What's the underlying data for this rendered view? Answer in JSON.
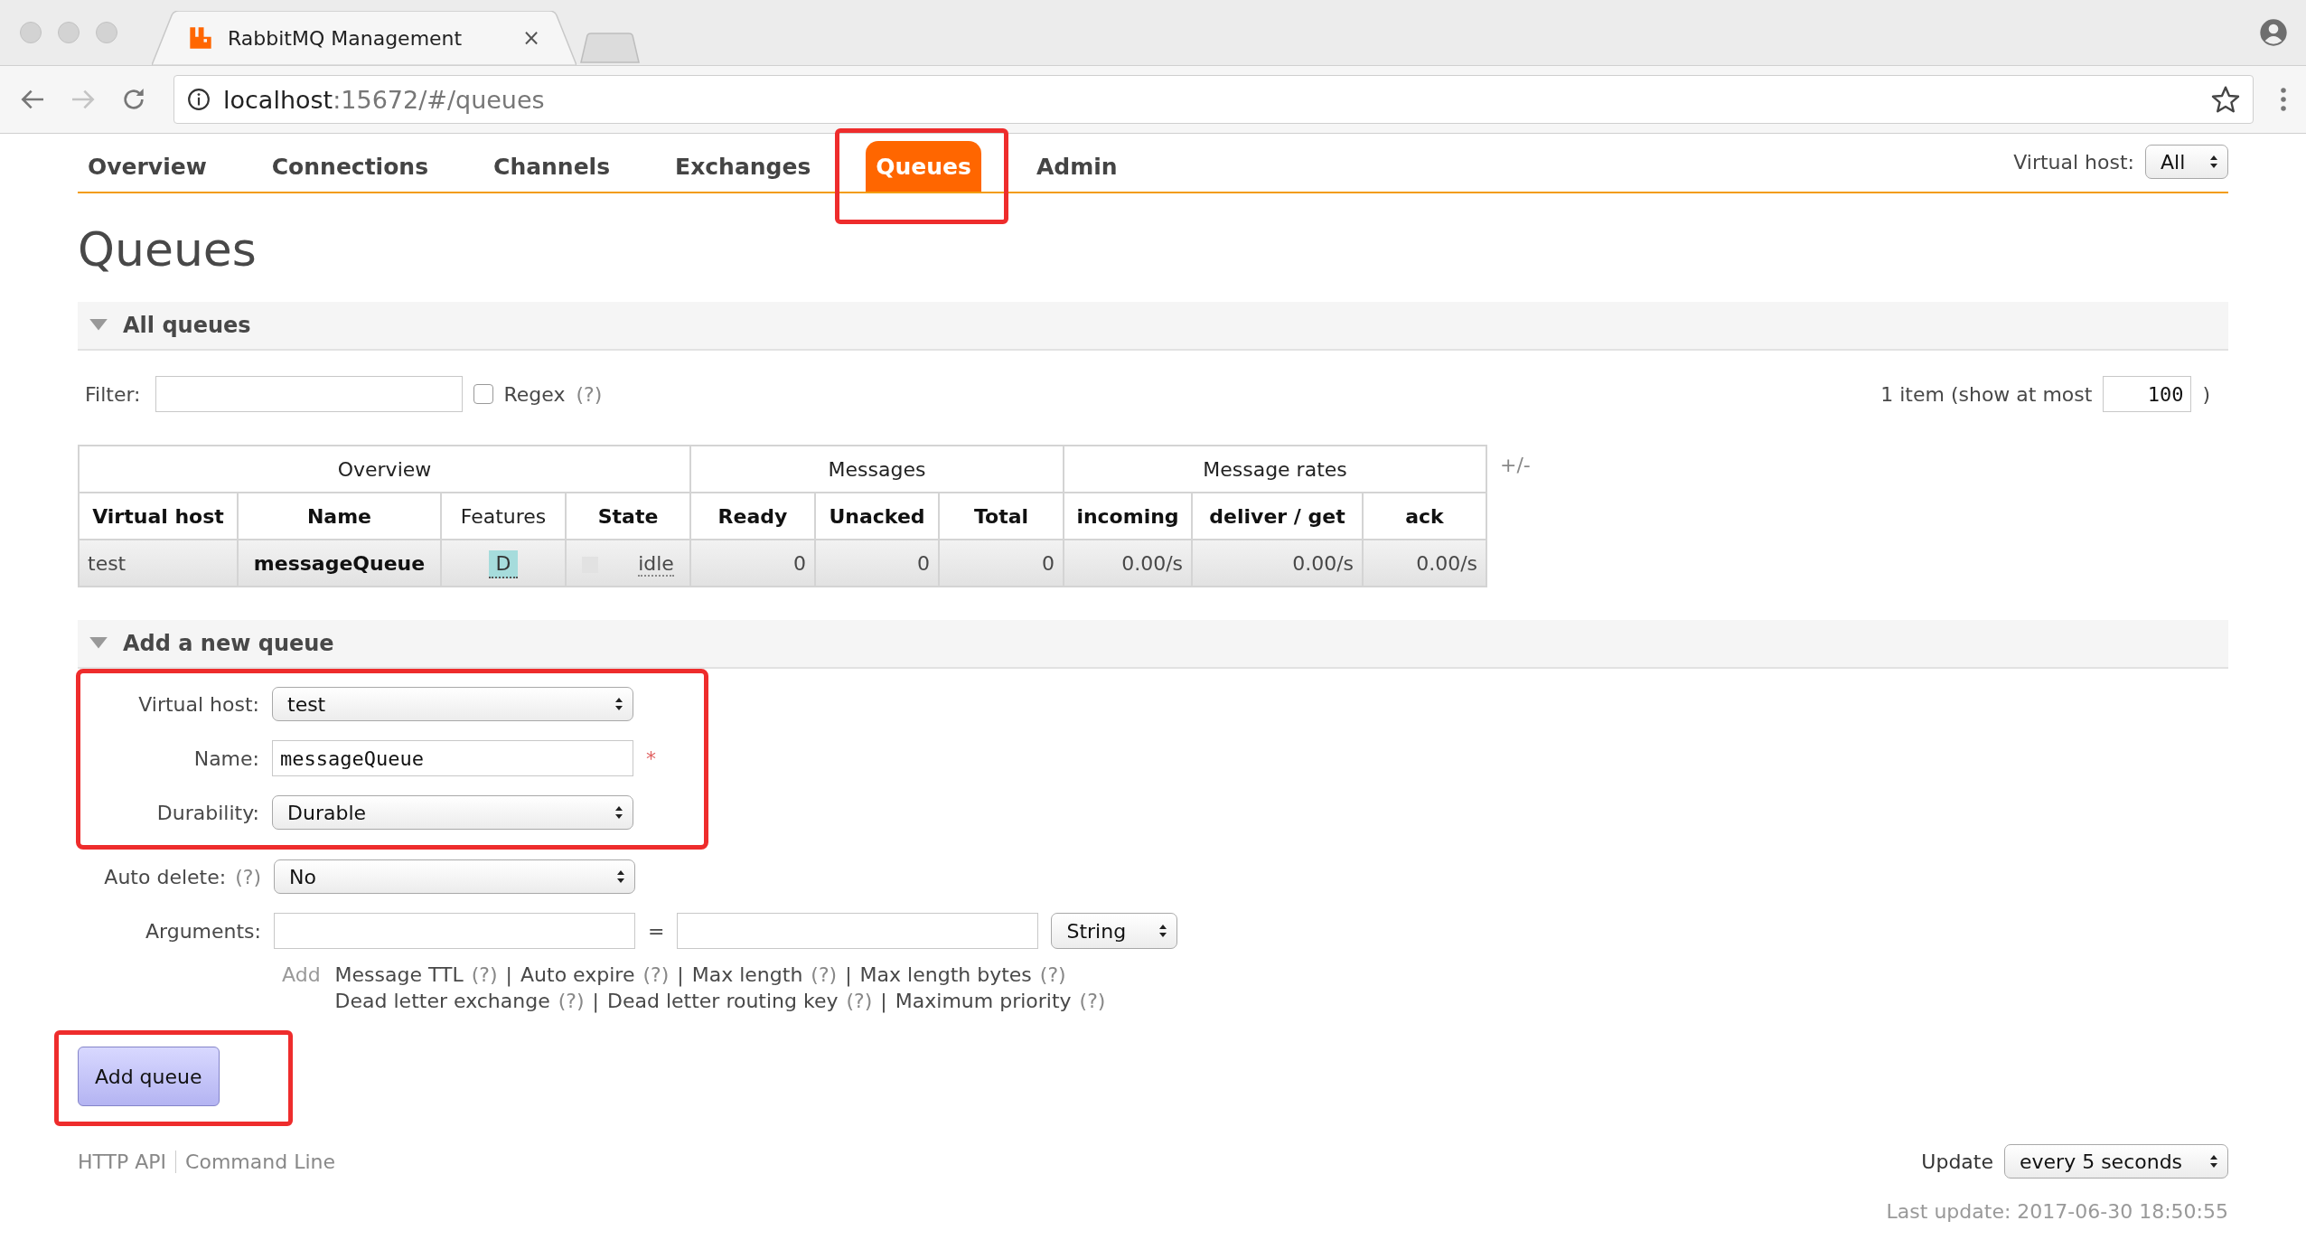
{
  "browser": {
    "tab_title": "RabbitMQ Management",
    "tab_close": "×",
    "url_host": "localhost",
    "url_rest": ":15672/#/queues"
  },
  "nav": {
    "tabs": [
      {
        "label": "Overview",
        "selected": false,
        "highlighted": false
      },
      {
        "label": "Connections",
        "selected": false,
        "highlighted": false
      },
      {
        "label": "Channels",
        "selected": false,
        "highlighted": false
      },
      {
        "label": "Exchanges",
        "selected": false,
        "highlighted": false
      },
      {
        "label": "Queues",
        "selected": true,
        "highlighted": true
      },
      {
        "label": "Admin",
        "selected": false,
        "highlighted": false
      }
    ],
    "vhost_label": "Virtual host:",
    "vhost_value": "All"
  },
  "page_title": "Queues",
  "all_queues": {
    "title": "All queues",
    "expanded": true,
    "filter_label": "Filter:",
    "regex_label": "Regex",
    "regex_checked": false,
    "regex_help": "(?)",
    "count_text": "1 item (show at most",
    "max_value": "100",
    "count_close": ")",
    "toggle_columns": "+/-",
    "table": {
      "groups": [
        {
          "label": "Overview"
        },
        {
          "label": "Messages"
        },
        {
          "label": "Message rates"
        }
      ],
      "columns": [
        {
          "label": "Virtual host",
          "sortable": true
        },
        {
          "label": "Name",
          "sortable": true
        },
        {
          "label": "Features",
          "sortable": false
        },
        {
          "label": "State",
          "sortable": true
        },
        {
          "label": "Ready",
          "sortable": true
        },
        {
          "label": "Unacked",
          "sortable": true
        },
        {
          "label": "Total",
          "sortable": true
        },
        {
          "label": "incoming",
          "sortable": true
        },
        {
          "label": "deliver / get",
          "sortable": true
        },
        {
          "label": "ack",
          "sortable": true
        }
      ],
      "rows": [
        {
          "cells": [
            {
              "kind": "text",
              "text": "test"
            },
            {
              "kind": "strong",
              "text": "messageQueue"
            },
            {
              "kind": "badges",
              "badges": [
                "D"
              ]
            },
            {
              "kind": "state",
              "text": "idle"
            },
            {
              "kind": "text",
              "text": "0"
            },
            {
              "kind": "text",
              "text": "0"
            },
            {
              "kind": "text",
              "text": "0"
            },
            {
              "kind": "text",
              "text": "0.00/s"
            },
            {
              "kind": "text",
              "text": "0.00/s"
            },
            {
              "kind": "text",
              "text": "0.00/s"
            }
          ]
        }
      ]
    }
  },
  "add_queue": {
    "title": "Add a new queue",
    "expanded": true,
    "groups": [
      {
        "highlighted": true,
        "rows": [
          {
            "kind": "select",
            "label": "Virtual host:",
            "value": "test"
          },
          {
            "kind": "input",
            "label": "Name:",
            "value": "messageQueue",
            "required_mark": "*"
          },
          {
            "kind": "select",
            "label": "Durability:",
            "value": "Durable"
          }
        ]
      },
      {
        "rows": [
          {
            "kind": "select",
            "label": "Auto delete:",
            "help": "(?)",
            "value": "No"
          },
          {
            "kind": "arguments",
            "label": "Arguments:",
            "separator": "=",
            "type_value": "String"
          }
        ]
      }
    ],
    "add_label": "Add",
    "argument_lines": [
      {
        "items": [
          {
            "label": "Message TTL",
            "help": "(?)",
            "separator": "|"
          },
          {
            "label": "Auto expire",
            "help": "(?)",
            "separator": "|"
          },
          {
            "label": "Max length",
            "help": "(?)",
            "separator": "|"
          },
          {
            "label": "Max length bytes",
            "help": "(?)"
          }
        ]
      },
      {
        "items": [
          {
            "label": "Dead letter exchange",
            "help": "(?)",
            "separator": "|"
          },
          {
            "label": "Dead letter routing key",
            "help": "(?)",
            "separator": "|"
          },
          {
            "label": "Maximum priority",
            "help": "(?)"
          }
        ]
      }
    ],
    "submit": {
      "label": "Add queue",
      "highlighted": true
    }
  },
  "footer": {
    "links": [
      "HTTP API",
      "Command Line"
    ],
    "update_label": "Update",
    "update_value": "every 5 seconds",
    "last_update": "Last update: 2017-06-30 18:50:55"
  }
}
